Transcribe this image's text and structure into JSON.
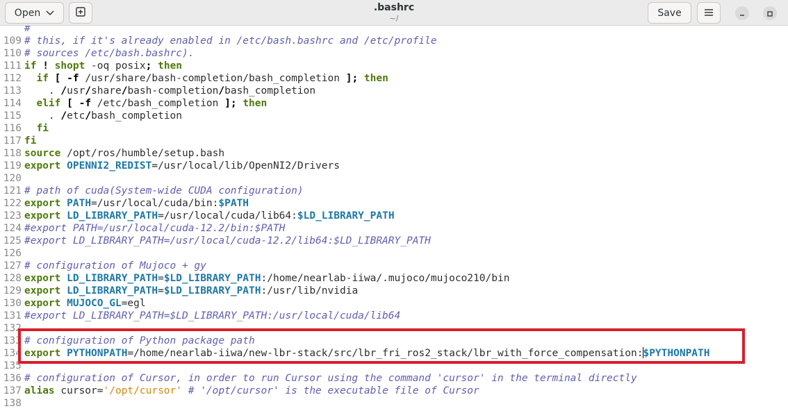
{
  "header": {
    "open_label": "Open",
    "title": ".bashrc",
    "subtitle": "~/",
    "save_label": "Save"
  },
  "lines": [
    {
      "num": "",
      "segs": [
        {
          "t": "# ",
          "c": "comment"
        },
        {
          "t": "    this, if it's already enabled in /etc/bash.bashrc and /etc/profile",
          "c": "hidden"
        }
      ]
    },
    {
      "num": "109",
      "segs": [
        {
          "t": "# this, if it's already enabled in /etc/bash.bashrc and /etc/profile",
          "c": "comment"
        }
      ]
    },
    {
      "num": "110",
      "segs": [
        {
          "t": "# sources /etc/bash.bashrc).",
          "c": "comment"
        }
      ]
    },
    {
      "num": "111",
      "segs": [
        {
          "t": "if",
          "c": "kw"
        },
        {
          "t": " ",
          "c": ""
        },
        {
          "t": "!",
          "c": "kw2"
        },
        {
          "t": " ",
          "c": ""
        },
        {
          "t": "shopt",
          "c": "kw"
        },
        {
          "t": " -oq posix",
          "c": ""
        },
        {
          "t": ";",
          "c": "kw2"
        },
        {
          "t": " ",
          "c": ""
        },
        {
          "t": "then",
          "c": "kw"
        }
      ]
    },
    {
      "num": "112",
      "segs": [
        {
          "t": "  ",
          "c": ""
        },
        {
          "t": "if",
          "c": "kw"
        },
        {
          "t": " ",
          "c": ""
        },
        {
          "t": "[",
          "c": "kw2"
        },
        {
          "t": " ",
          "c": ""
        },
        {
          "t": "-f",
          "c": "kw2"
        },
        {
          "t": " /usr/share/bash-completion/bash_completion ",
          "c": ""
        },
        {
          "t": "];",
          "c": "kw2"
        },
        {
          "t": " ",
          "c": ""
        },
        {
          "t": "then",
          "c": "kw"
        }
      ]
    },
    {
      "num": "113",
      "segs": [
        {
          "t": "    . ",
          "c": ""
        },
        {
          "t": "/",
          "c": "kw2"
        },
        {
          "t": "usr",
          "c": ""
        },
        {
          "t": "/",
          "c": "kw2"
        },
        {
          "t": "share",
          "c": ""
        },
        {
          "t": "/",
          "c": "kw2"
        },
        {
          "t": "bash-completion",
          "c": ""
        },
        {
          "t": "/",
          "c": "kw2"
        },
        {
          "t": "bash_completion",
          "c": ""
        }
      ]
    },
    {
      "num": "114",
      "segs": [
        {
          "t": "  ",
          "c": ""
        },
        {
          "t": "elif",
          "c": "kw"
        },
        {
          "t": " ",
          "c": ""
        },
        {
          "t": "[",
          "c": "kw2"
        },
        {
          "t": " ",
          "c": ""
        },
        {
          "t": "-f",
          "c": "kw2"
        },
        {
          "t": " /etc/bash_completion ",
          "c": ""
        },
        {
          "t": "];",
          "c": "kw2"
        },
        {
          "t": " ",
          "c": ""
        },
        {
          "t": "then",
          "c": "kw"
        }
      ]
    },
    {
      "num": "115",
      "segs": [
        {
          "t": "    . ",
          "c": ""
        },
        {
          "t": "/",
          "c": "kw2"
        },
        {
          "t": "etc",
          "c": ""
        },
        {
          "t": "/",
          "c": "kw2"
        },
        {
          "t": "bash_completion",
          "c": ""
        }
      ]
    },
    {
      "num": "116",
      "segs": [
        {
          "t": "  ",
          "c": ""
        },
        {
          "t": "fi",
          "c": "kw"
        }
      ]
    },
    {
      "num": "117",
      "segs": [
        {
          "t": "fi",
          "c": "kw"
        }
      ]
    },
    {
      "num": "118",
      "segs": [
        {
          "t": "source",
          "c": "kw"
        },
        {
          "t": " /opt/ros/humble/setup.bash",
          "c": ""
        }
      ]
    },
    {
      "num": "119",
      "segs": [
        {
          "t": "export",
          "c": "kw"
        },
        {
          "t": " ",
          "c": ""
        },
        {
          "t": "OPENNI2_REDIST",
          "c": "var"
        },
        {
          "t": "=/usr/local/lib/OpenNI2/Drivers",
          "c": ""
        }
      ]
    },
    {
      "num": "120",
      "segs": []
    },
    {
      "num": "121",
      "segs": [
        {
          "t": "# path of cuda(System-wide CUDA configuration)",
          "c": "comment"
        }
      ]
    },
    {
      "num": "122",
      "segs": [
        {
          "t": "export",
          "c": "kw"
        },
        {
          "t": " ",
          "c": ""
        },
        {
          "t": "PATH",
          "c": "var"
        },
        {
          "t": "=/usr/local/cuda/bin:",
          "c": ""
        },
        {
          "t": "$PATH",
          "c": "var"
        }
      ]
    },
    {
      "num": "123",
      "segs": [
        {
          "t": "export",
          "c": "kw"
        },
        {
          "t": " ",
          "c": ""
        },
        {
          "t": "LD_LIBRARY_PATH",
          "c": "var"
        },
        {
          "t": "=/usr/local/cuda/lib64:",
          "c": ""
        },
        {
          "t": "$LD_LIBRARY_PATH",
          "c": "var"
        }
      ]
    },
    {
      "num": "124",
      "segs": [
        {
          "t": "#export PATH=/usr/local/cuda-12.2/bin:$PATH",
          "c": "comment"
        }
      ]
    },
    {
      "num": "125",
      "segs": [
        {
          "t": "#export LD_LIBRARY_PATH=/usr/local/cuda-12.2/lib64:$LD_LIBRARY_PATH",
          "c": "comment"
        }
      ]
    },
    {
      "num": "126",
      "segs": []
    },
    {
      "num": "127",
      "segs": [
        {
          "t": "# configuration of Mujoco + gy",
          "c": "comment"
        }
      ]
    },
    {
      "num": "128",
      "segs": [
        {
          "t": "export",
          "c": "kw"
        },
        {
          "t": " ",
          "c": ""
        },
        {
          "t": "LD_LIBRARY_PATH",
          "c": "var"
        },
        {
          "t": "=",
          "c": ""
        },
        {
          "t": "$LD_LIBRARY_PATH",
          "c": "var"
        },
        {
          "t": ":/home/nearlab-iiwa/.mujoco/mujoco210/bin",
          "c": ""
        }
      ]
    },
    {
      "num": "129",
      "segs": [
        {
          "t": "export",
          "c": "kw"
        },
        {
          "t": " ",
          "c": ""
        },
        {
          "t": "LD_LIBRARY_PATH",
          "c": "var"
        },
        {
          "t": "=",
          "c": ""
        },
        {
          "t": "$LD_LIBRARY_PATH",
          "c": "var"
        },
        {
          "t": ":/usr/lib/nvidia",
          "c": ""
        }
      ]
    },
    {
      "num": "130",
      "segs": [
        {
          "t": "export",
          "c": "kw"
        },
        {
          "t": " ",
          "c": ""
        },
        {
          "t": "MUJOCO_GL",
          "c": "var"
        },
        {
          "t": "=egl",
          "c": ""
        }
      ]
    },
    {
      "num": "131",
      "segs": [
        {
          "t": "#export LD_LIBRARY_PATH=$LD_LIBRARY_PATH:/usr/local/cuda/lib64",
          "c": "comment"
        }
      ]
    },
    {
      "num": "132",
      "segs": []
    },
    {
      "num": "133",
      "segs": [
        {
          "t": "# configuration of Python package path",
          "c": "comment"
        }
      ]
    },
    {
      "num": "134",
      "segs": [
        {
          "t": "export",
          "c": "kw"
        },
        {
          "t": " ",
          "c": ""
        },
        {
          "t": "PYTHONPATH",
          "c": "var"
        },
        {
          "t": "=/home/nearlab-iiwa/new-lbr-stack/src/lbr_fri_ros2_stack/lbr_with_force_compensation:",
          "c": ""
        },
        {
          "t": "|",
          "c": "cursor"
        },
        {
          "t": "$PYTHONPATH",
          "c": "var"
        }
      ]
    },
    {
      "num": "135",
      "segs": []
    },
    {
      "num": "136",
      "segs": [
        {
          "t": "# configuration of Cursor, in order to run Cursor using the command 'cursor' in the terminal directly",
          "c": "comment"
        }
      ]
    },
    {
      "num": "137",
      "segs": [
        {
          "t": "alias",
          "c": "kw"
        },
        {
          "t": " cursor=",
          "c": ""
        },
        {
          "t": "'/opt/cursor'",
          "c": "str"
        },
        {
          "t": " ",
          "c": ""
        },
        {
          "t": "# '/opt/cursor' is the executable file of Cursor",
          "c": "comment"
        }
      ]
    },
    {
      "num": "138",
      "segs": []
    },
    {
      "num": "139",
      "segs": [
        {
          "t": "# ",
          "c": "comment"
        }
      ]
    }
  ],
  "icons": {
    "open_dropdown": "chevron-down-icon",
    "new_tab": "new-document-icon",
    "menu": "hamburger-menu-icon",
    "minimize": "minimize-icon",
    "maximize": "maximize-icon"
  },
  "colors": {
    "highlight_box": "#d91e2a",
    "keyword": "#4e7a0b",
    "comment": "#5f5fb0",
    "variable": "#1d78a6",
    "string": "#d5880f"
  }
}
